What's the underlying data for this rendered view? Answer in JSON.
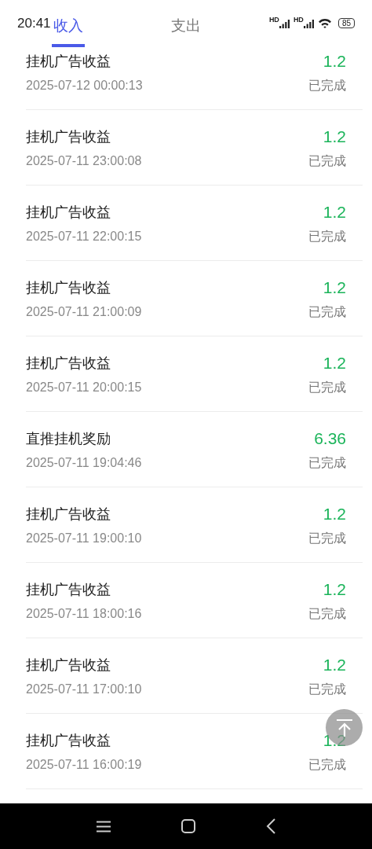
{
  "status_bar": {
    "time": "20:41",
    "network_labels": [
      "HD",
      "HD"
    ],
    "battery": "85"
  },
  "tabs": [
    {
      "label": "收入",
      "selected": true
    },
    {
      "label": "支出",
      "selected": false
    }
  ],
  "records": [
    {
      "title": "挂机广告收益",
      "time": "2025-07-12 00:00:13",
      "amount": "1.2",
      "status": "已完成"
    },
    {
      "title": "挂机广告收益",
      "time": "2025-07-11 23:00:08",
      "amount": "1.2",
      "status": "已完成"
    },
    {
      "title": "挂机广告收益",
      "time": "2025-07-11 22:00:15",
      "amount": "1.2",
      "status": "已完成"
    },
    {
      "title": "挂机广告收益",
      "time": "2025-07-11 21:00:09",
      "amount": "1.2",
      "status": "已完成"
    },
    {
      "title": "挂机广告收益",
      "time": "2025-07-11 20:00:15",
      "amount": "1.2",
      "status": "已完成"
    },
    {
      "title": "直推挂机奖励",
      "time": "2025-07-11 19:04:46",
      "amount": "6.36",
      "status": "已完成"
    },
    {
      "title": "挂机广告收益",
      "time": "2025-07-11 19:00:10",
      "amount": "1.2",
      "status": "已完成"
    },
    {
      "title": "挂机广告收益",
      "time": "2025-07-11 18:00:16",
      "amount": "1.2",
      "status": "已完成"
    },
    {
      "title": "挂机广告收益",
      "time": "2025-07-11 17:00:10",
      "amount": "1.2",
      "status": "已完成"
    },
    {
      "title": "挂机广告收益",
      "time": "2025-07-11 16:00:19",
      "amount": "1.2",
      "status": "已完成"
    }
  ]
}
